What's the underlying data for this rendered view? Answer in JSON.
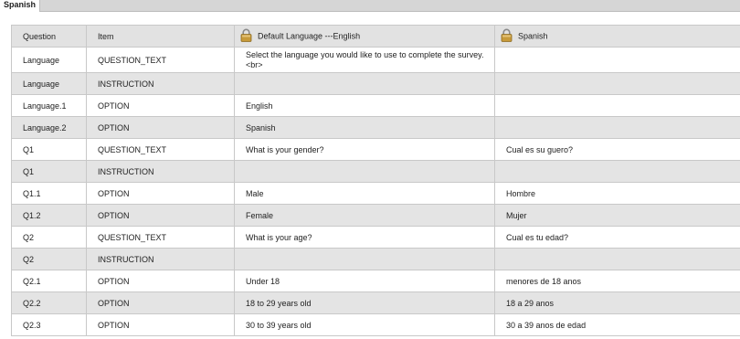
{
  "tabs": {
    "active": "Spanish"
  },
  "table": {
    "headers": {
      "question": "Question",
      "item": "Item",
      "default_language": "Default Language ---English",
      "spanish": "Spanish"
    },
    "rows": [
      {
        "question": "Language",
        "item": "QUESTION_TEXT",
        "english": "Select the language you would like to use to complete the survey.<br>",
        "spanish": ""
      },
      {
        "question": "Language",
        "item": "INSTRUCTION",
        "english": "",
        "spanish": ""
      },
      {
        "question": "Language.1",
        "item": "OPTION",
        "english": "English",
        "spanish": ""
      },
      {
        "question": "Language.2",
        "item": "OPTION",
        "english": "Spanish",
        "spanish": ""
      },
      {
        "question": "Q1",
        "item": "QUESTION_TEXT",
        "english": "What is your gender?",
        "spanish": "Cual es su guero?"
      },
      {
        "question": "Q1",
        "item": "INSTRUCTION",
        "english": "",
        "spanish": ""
      },
      {
        "question": "Q1.1",
        "item": "OPTION",
        "english": "Male",
        "spanish": "Hombre"
      },
      {
        "question": "Q1.2",
        "item": "OPTION",
        "english": "Female",
        "spanish": "Mujer"
      },
      {
        "question": "Q2",
        "item": "QUESTION_TEXT",
        "english": "What is your age?",
        "spanish": "Cual es tu edad?"
      },
      {
        "question": "Q2",
        "item": "INSTRUCTION",
        "english": "",
        "spanish": ""
      },
      {
        "question": "Q2.1",
        "item": "OPTION",
        "english": "Under 18",
        "spanish": "menores de 18 anos"
      },
      {
        "question": "Q2.2",
        "item": "OPTION",
        "english": "18 to 29 years old",
        "spanish": "18 a 29 anos"
      },
      {
        "question": "Q2.3",
        "item": "OPTION",
        "english": "30 to 39 years old",
        "spanish": "30 a 39 anos de edad"
      }
    ]
  },
  "icons": {
    "lock": "lock-icon"
  },
  "colors": {
    "tabbar": "#d6d6d6",
    "header_bg": "#e2e2e2",
    "row_alt": "#e4e4e4",
    "border": "#c8c8c8",
    "lock_body": "#c79a3a"
  }
}
